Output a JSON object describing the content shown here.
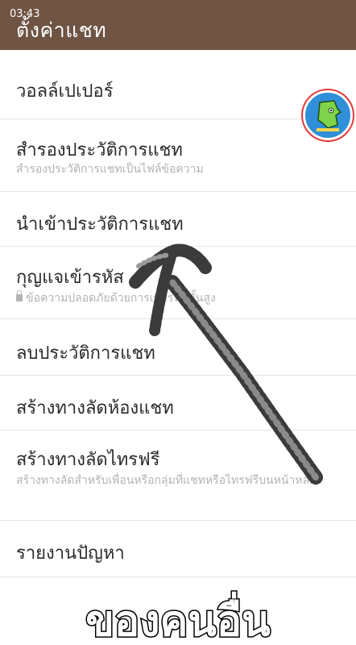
{
  "status": {
    "time": "03:43"
  },
  "header": {
    "title": "ตั้งค่าแชท"
  },
  "menu": {
    "items": [
      {
        "title": "วอลล์เปเปอร์"
      },
      {
        "title": "สำรองประวัติการแชท",
        "subtitle": "สำรองประวัติการแชทเป็นไฟล์ข้อความ"
      },
      {
        "title": "นำเข้าประวัติการแชท"
      },
      {
        "title": "กุญแจเข้ารหัส",
        "subtitle": "ข้อความปลอดภัยด้วยการเข้ารหัสขั้นสูง"
      },
      {
        "title": "ลบประวัติการแชท"
      },
      {
        "title": "สร้างทางลัดห้องแชท"
      },
      {
        "title": "สร้างทางลัดไทรฟรี",
        "subtitle": "สร้างทางลัดสำหรับเพื่อนหรือกลุ่มที่แชทหรือไทรฟรีบนหน้าหลัก"
      },
      {
        "title": "รายงานปัญหา"
      }
    ]
  },
  "caption": "ของคนอื่น",
  "colors": {
    "header": "#6f5444",
    "divider": "#e6e6e6",
    "subtitle": "#b3b3b3"
  }
}
